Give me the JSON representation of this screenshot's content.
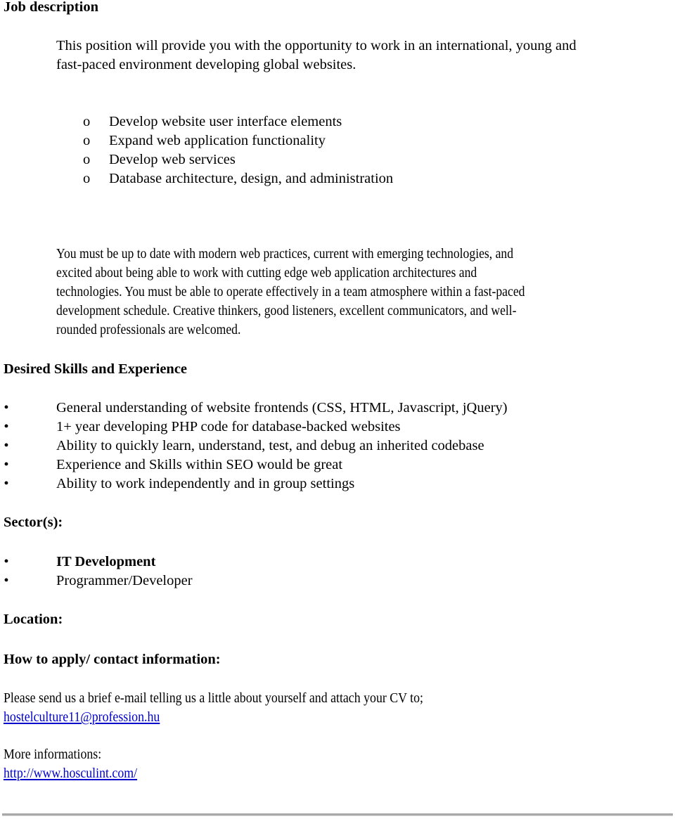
{
  "job_description": {
    "heading": "Job description",
    "intro_line1": "This position will provide you with the opportunity to work in an international, young and",
    "intro_line2": "fast-paced environment developing global websites.",
    "duties_marker": "o",
    "duties": [
      "Develop website user interface elements",
      "Expand web application functionality",
      "Develop web services",
      "Database architecture, design, and administration"
    ],
    "requirements_lines": [
      "You must be up to date with modern web practices, current with emerging technologies, and",
      "excited about being able to work with cutting edge web application architectures and",
      "technologies. You must be able to operate effectively in a team atmosphere within a fast-paced",
      "development schedule. Creative thinkers, good listeners, excellent communicators, and well-",
      "rounded professionals are welcomed."
    ]
  },
  "desired_skills": {
    "heading": "Desired Skills and Experience",
    "bullet_marker": "•",
    "items": [
      "General understanding of website frontends (CSS, HTML, Javascript, jQuery)",
      "1+ year developing PHP code for database-backed websites",
      "Ability to quickly learn, understand, test, and debug an inherited codebase",
      "Experience and Skills within SEO would be great",
      "Ability to work independently and in group settings"
    ]
  },
  "sectors": {
    "heading": "Sector(s):",
    "items": [
      {
        "label": "IT Development",
        "bold": true
      },
      {
        "label": "Programmer/Developer",
        "bold": false
      }
    ]
  },
  "location": {
    "heading": "Location:"
  },
  "contact": {
    "heading": "How to apply/ contact information:",
    "text": "Please send us a brief e-mail telling us a little about yourself and attach your CV to;",
    "email": "hostelculture11@profession.hu",
    "more_label": "More informations:",
    "website": "http://www.hosculint.com/"
  },
  "colors": {
    "link": "#0000cc",
    "rule": "#a8a8a8"
  }
}
